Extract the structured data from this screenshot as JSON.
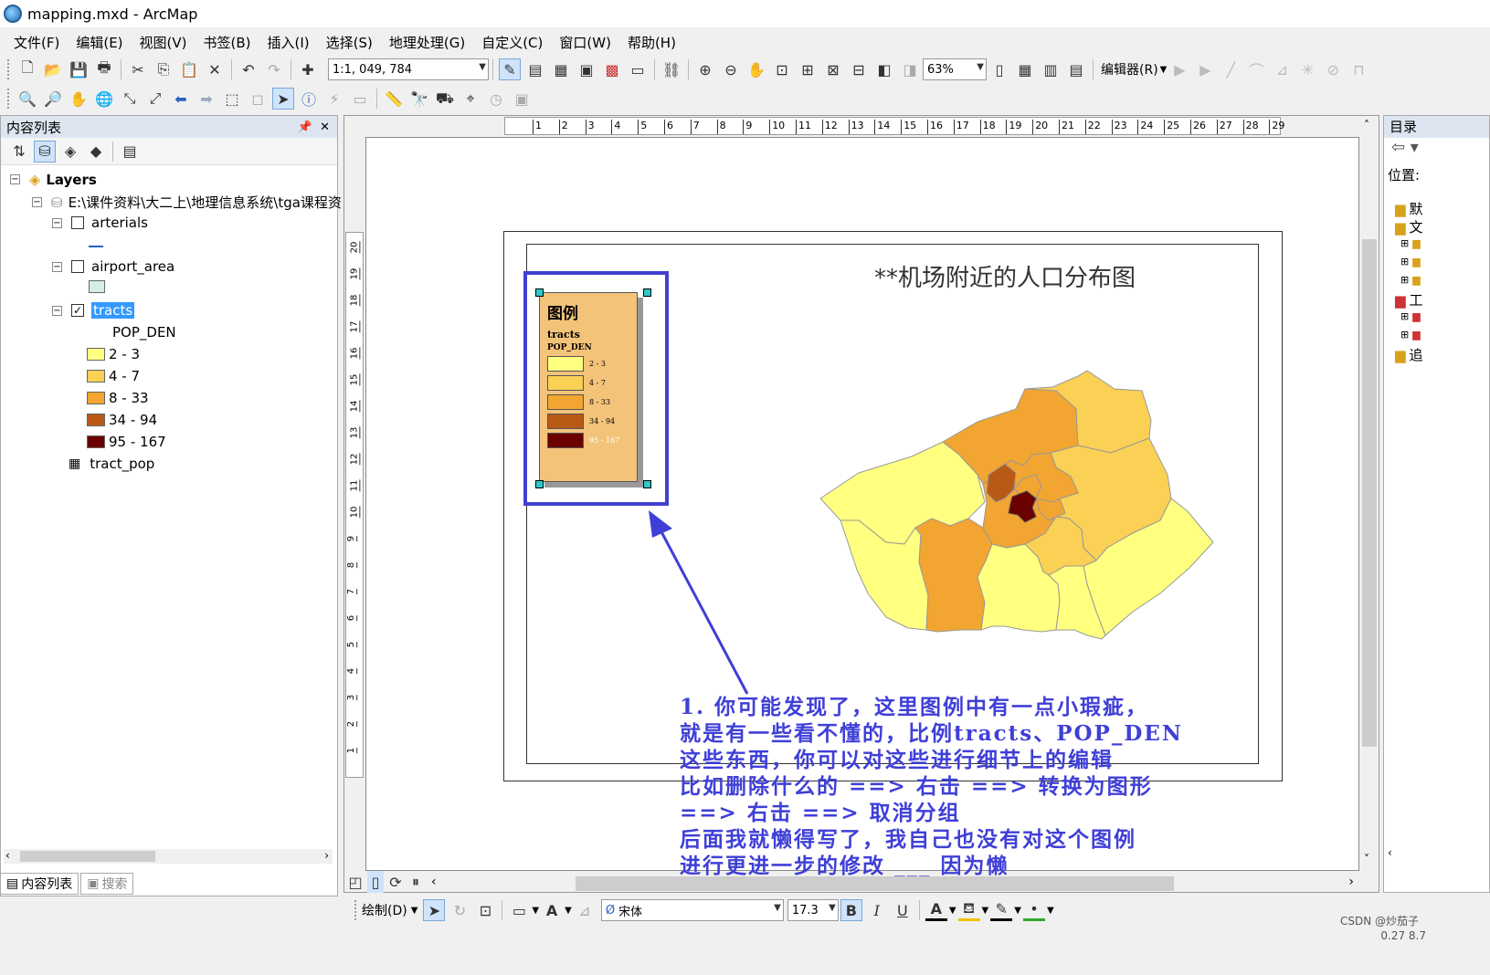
{
  "window": {
    "title": "mapping.mxd - ArcMap"
  },
  "menu": [
    "文件(F)",
    "编辑(E)",
    "视图(V)",
    "书签(B)",
    "插入(I)",
    "选择(S)",
    "地理处理(G)",
    "自定义(C)",
    "窗口(W)",
    "帮助(H)"
  ],
  "toolbar": {
    "scale": "1:1, 049, 784",
    "zoom": "63%",
    "editor": "编辑器(R)"
  },
  "toc": {
    "title": "内容列表",
    "pin": "ᵖ",
    "root": "Layers",
    "source": "E:\\课件资料\\大二上\\地理信息系统\\tga课程资",
    "layers": [
      {
        "name": "arterials",
        "checked": false
      },
      {
        "name": "airport_area",
        "checked": false
      },
      {
        "name": "tracts",
        "checked": true
      }
    ],
    "field": "POP_DEN",
    "classes": [
      {
        "label": "2 - 3",
        "color": "#ffff80"
      },
      {
        "label": "4 - 7",
        "color": "#fad055"
      },
      {
        "label": "8 - 33",
        "color": "#f2a530"
      },
      {
        "label": "34 - 94",
        "color": "#b85a15"
      },
      {
        "label": "95 - 167",
        "color": "#6b0000"
      }
    ],
    "table": "tract_pop",
    "tabs": [
      "内容列表",
      "搜索"
    ]
  },
  "map": {
    "title": "**机场附近的人口分布图"
  },
  "legend": {
    "title": "图例",
    "layer": "tracts",
    "field": "POP_DEN",
    "items": [
      "2 - 3",
      "4 - 7",
      "8 - 33",
      "34 - 94",
      "95 - 167"
    ]
  },
  "annotation": [
    "1. 你可能发现了，这里图例中有一点小瑕疵，",
    "就是有一些看不懂的，比例tracts、POP_DEN",
    "这些东西，你可以对这些进行细节上的编辑",
    "比如删除什么的 ==> 右击 ==> 转换为图形",
    "==> 右击 ==> 取消分组",
    "后面我就懒得写了，我自己也没有对这个图例",
    "进行更进一步的修改 ___ 因为懒"
  ],
  "catalog": {
    "title": "目录",
    "location": "位置:",
    "items": [
      "默",
      "文",
      "工",
      "追"
    ]
  },
  "drawbar": {
    "draw": "绘制(D)",
    "font": "宋体",
    "size": "17.3",
    "bold": "B",
    "italic": "I",
    "underline": "U"
  },
  "status": {
    "coords": "0.27  8.7",
    "watermark": "CSDN @炒茄子"
  },
  "ruler": {
    "top": [
      "1",
      "2",
      "3",
      "4",
      "5",
      "6",
      "7",
      "8",
      "9",
      "10",
      "11",
      "12",
      "13",
      "14",
      "15",
      "16",
      "17",
      "18",
      "19",
      "20",
      "21",
      "22",
      "23",
      "24",
      "25",
      "26",
      "27",
      "28",
      "29"
    ],
    "left": [
      "20",
      "19",
      "18",
      "17",
      "16",
      "15",
      "14",
      "13",
      "12",
      "11",
      "10",
      "9",
      "8",
      "7",
      "6",
      "5",
      "4",
      "3",
      "2",
      "1"
    ]
  }
}
